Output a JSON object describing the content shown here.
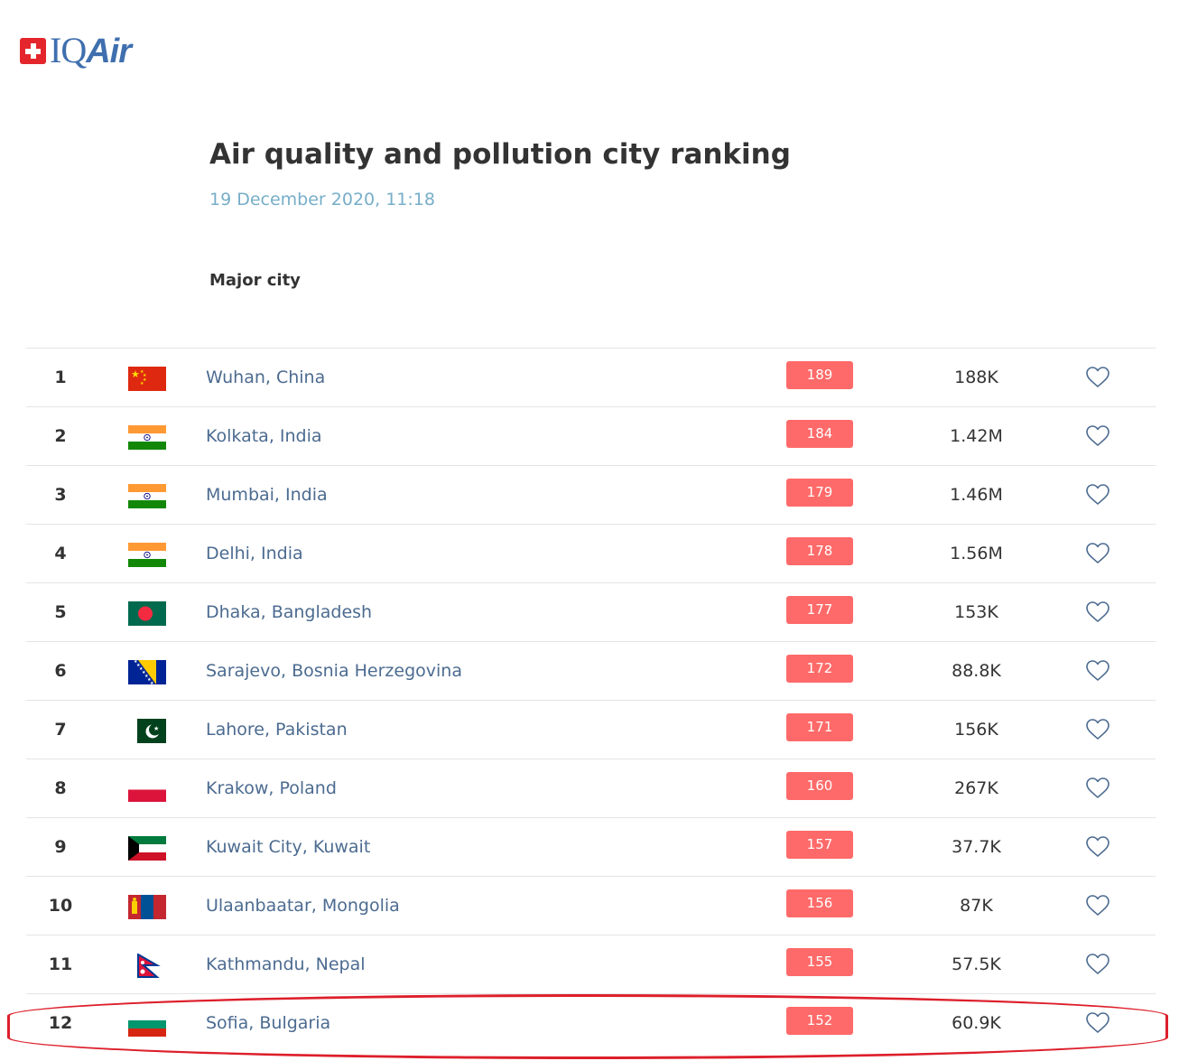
{
  "brand": {
    "logo_text": "IQ",
    "logo_text_italic": "Air"
  },
  "header": {
    "title": "Air quality and pollution city ranking",
    "date": "19 December 2020, 11:18",
    "section_label": "Major city"
  },
  "colors": {
    "aqi_badge": "#fe6a69",
    "city_link": "#4c6b90",
    "date": "#77aec9",
    "highlight": "#dd1f2b",
    "logo_blue": "#3f6fae"
  },
  "rows": [
    {
      "rank": "1",
      "city": "Wuhan, China",
      "flag": "china-flag",
      "aqi": "189",
      "population": "188K"
    },
    {
      "rank": "2",
      "city": "Kolkata, India",
      "flag": "india-flag",
      "aqi": "184",
      "population": "1.42M"
    },
    {
      "rank": "3",
      "city": "Mumbai, India",
      "flag": "india-flag",
      "aqi": "179",
      "population": "1.46M"
    },
    {
      "rank": "4",
      "city": "Delhi, India",
      "flag": "india-flag",
      "aqi": "178",
      "population": "1.56M"
    },
    {
      "rank": "5",
      "city": "Dhaka, Bangladesh",
      "flag": "bangladesh-flag",
      "aqi": "177",
      "population": "153K"
    },
    {
      "rank": "6",
      "city": "Sarajevo, Bosnia Herzegovina",
      "flag": "bosnia-flag",
      "aqi": "172",
      "population": "88.8K"
    },
    {
      "rank": "7",
      "city": "Lahore, Pakistan",
      "flag": "pakistan-flag",
      "aqi": "171",
      "population": "156K"
    },
    {
      "rank": "8",
      "city": "Krakow, Poland",
      "flag": "poland-flag",
      "aqi": "160",
      "population": "267K"
    },
    {
      "rank": "9",
      "city": "Kuwait City, Kuwait",
      "flag": "kuwait-flag",
      "aqi": "157",
      "population": "37.7K"
    },
    {
      "rank": "10",
      "city": "Ulaanbaatar, Mongolia",
      "flag": "mongolia-flag",
      "aqi": "156",
      "population": "87K"
    },
    {
      "rank": "11",
      "city": "Kathmandu, Nepal",
      "flag": "nepal-flag",
      "aqi": "155",
      "population": "57.5K"
    },
    {
      "rank": "12",
      "city": "Sofia, Bulgaria",
      "flag": "bulgaria-flag",
      "aqi": "152",
      "population": "60.9K"
    }
  ]
}
